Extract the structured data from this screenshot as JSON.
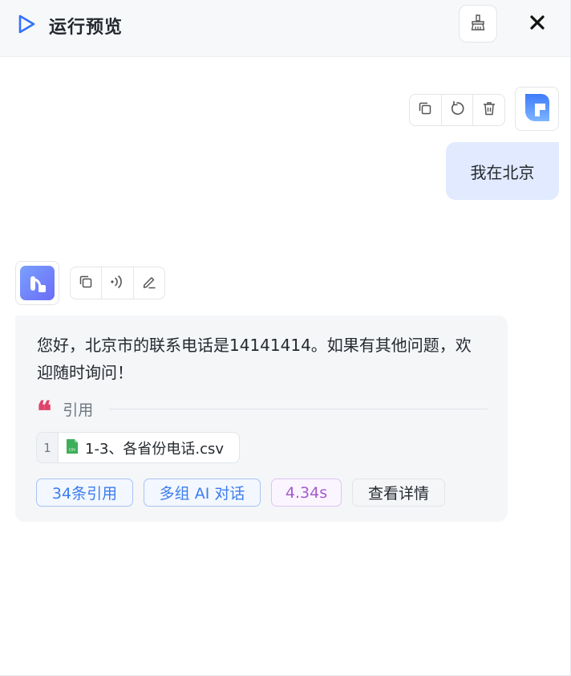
{
  "header": {
    "title": "运行预览",
    "icons": {
      "play": "play-icon",
      "clear": "broom-icon",
      "close": "close-icon"
    },
    "accent": "#3370ff"
  },
  "user_message": {
    "text": "我在北京",
    "actions": [
      "copy-icon",
      "retry-icon",
      "delete-icon"
    ],
    "bubble_color": "#e1eaff"
  },
  "ai_message": {
    "text": "您好，北京市的联系电话是14141414。如果有其他问题，欢迎随时询问！",
    "actions": [
      "copy-icon",
      "speaker-icon",
      "edit-icon"
    ],
    "quote": {
      "mark": "❝",
      "label": "引用"
    },
    "citation": {
      "index": "1",
      "file_name": "1-3、各省份电话.csv",
      "file_icon": "csv-file-icon"
    },
    "tags": {
      "citations": "34条引用",
      "multi_ai": "多组 AI 对话",
      "duration": "4.34s",
      "details": "查看详情"
    },
    "colors": {
      "quote": "#e0446a",
      "tag_blue": "#3b7ded",
      "tag_purple": "#a55bcd"
    }
  }
}
